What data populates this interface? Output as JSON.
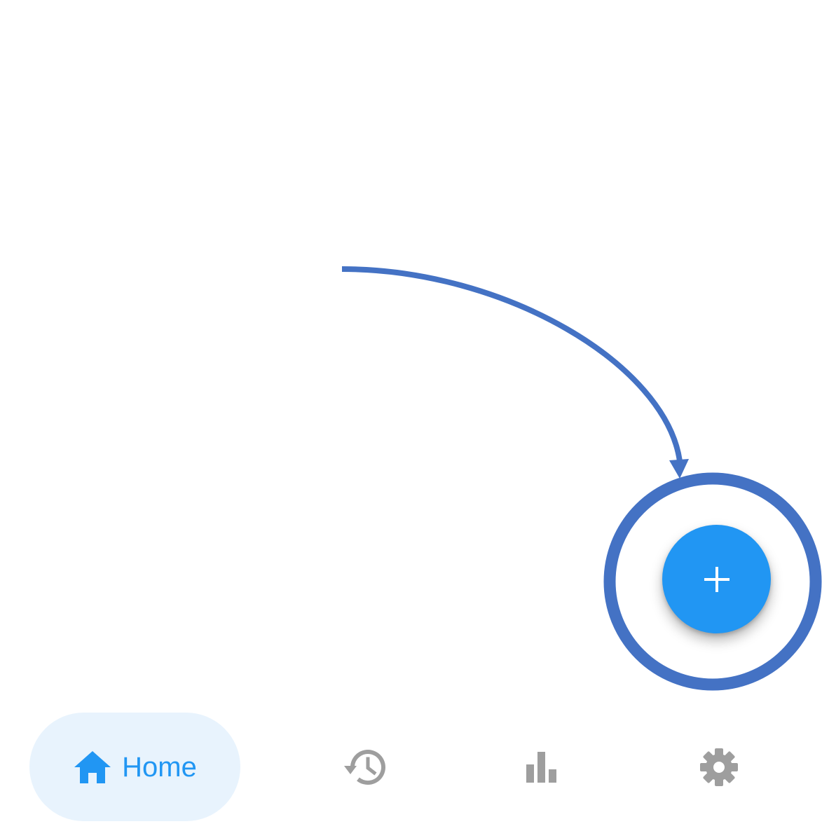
{
  "fab": {
    "icon": "plus-icon",
    "color": "#2196F3"
  },
  "annotation": {
    "color": "#4472C4",
    "shape": "curved arrow pointing to circled add button"
  },
  "bottom_nav": {
    "items": [
      {
        "id": "home",
        "label": "Home",
        "icon": "home-icon",
        "active": true
      },
      {
        "id": "history",
        "icon": "history-icon",
        "active": false
      },
      {
        "id": "stats",
        "icon": "bar-chart-icon",
        "active": false
      },
      {
        "id": "settings",
        "icon": "gear-icon",
        "active": false
      }
    ],
    "active_color": "#2196F3",
    "active_bg": "#E8F3FD",
    "inactive_color": "#9E9E9E"
  }
}
